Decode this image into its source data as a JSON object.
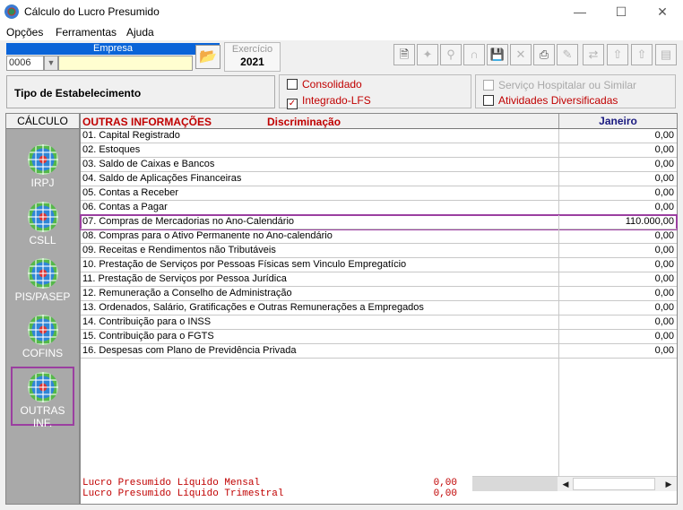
{
  "window": {
    "title": "Cálculo do Lucro Presumido"
  },
  "menu": [
    "Opções",
    "Ferramentas",
    "Ajuda"
  ],
  "empresa": {
    "label": "Empresa",
    "code": "0006",
    "name": ""
  },
  "exercicio": {
    "label": "Exercício",
    "value": "2021"
  },
  "tipo": {
    "label": "Tipo de Estabelecimento"
  },
  "checks": {
    "consolidado": {
      "label": "Consolidado",
      "checked": false
    },
    "integrado": {
      "label": "Integrado-LFS",
      "checked": true
    },
    "servico": {
      "label": "Serviço Hospitalar ou Similar",
      "checked": false
    },
    "atividades": {
      "label": "Atividades Diversificadas",
      "checked": false
    }
  },
  "sidebar": {
    "header": "CÁLCULO",
    "items": [
      {
        "label": "IRPJ"
      },
      {
        "label": "CSLL"
      },
      {
        "label": "PIS/PASEP"
      },
      {
        "label": "COFINS"
      },
      {
        "label": "OUTRAS INF."
      }
    ],
    "active_index": 4
  },
  "grid": {
    "header_section": "OUTRAS INFORMAÇÕES",
    "header_desc": "Discriminação",
    "header_month": "Janeiro",
    "rows": [
      {
        "desc": "01. Capital Registrado",
        "value": "0,00"
      },
      {
        "desc": "02. Estoques",
        "value": "0,00"
      },
      {
        "desc": "03. Saldo de Caixas e Bancos",
        "value": "0,00"
      },
      {
        "desc": "04. Saldo de Aplicações Financeiras",
        "value": "0,00"
      },
      {
        "desc": "05. Contas a Receber",
        "value": "0,00"
      },
      {
        "desc": "06. Contas a Pagar",
        "value": "0,00"
      },
      {
        "desc": "07. Compras de Mercadorias no Ano-Calendário",
        "value": "110.000,00"
      },
      {
        "desc": "08. Compras para o Ativo Permanente no Ano-calendário",
        "value": "0,00"
      },
      {
        "desc": "09. Receitas e Rendimentos não Tributáveis",
        "value": "0,00"
      },
      {
        "desc": "10. Prestação de Serviços por Pessoas Físicas sem Vinculo Empregatício",
        "value": "0,00"
      },
      {
        "desc": "11. Prestação de Serviços por Pessoa Jurídica",
        "value": "0,00"
      },
      {
        "desc": "12. Remuneração a Conselho de Administração",
        "value": "0,00"
      },
      {
        "desc": "13. Ordenados, Salário, Gratificações e Outras Remunerações a Empregados",
        "value": "0,00"
      },
      {
        "desc": "14. Contribuição para o INSS",
        "value": "0,00"
      },
      {
        "desc": "15. Contribuição para o FGTS",
        "value": "0,00"
      },
      {
        "desc": "16. Despesas com Plano de Previdência Privada",
        "value": "0,00"
      }
    ],
    "highlighted_index": 6
  },
  "footer": {
    "mensal_label": "Lucro Presumido Líquido Mensal",
    "mensal_value": "0,00",
    "trimestral_label": "Lucro Presumido Líquido Trimestral",
    "trimestral_value": "0,00"
  },
  "toolbar_icons": [
    "new-doc-icon",
    "navigate-icon",
    "search-icon",
    "magnet-icon",
    "save-icon",
    "delete-icon",
    "print-icon",
    "tool-icon",
    "export-icon",
    "upload-icon",
    "upload-alt-icon",
    "report-icon"
  ],
  "colors": {
    "accent_red": "#c00000",
    "highlight": "#9b3fa0",
    "empresa_bar": "#0a64d8",
    "sidebar_bg": "#a9a9a9"
  }
}
